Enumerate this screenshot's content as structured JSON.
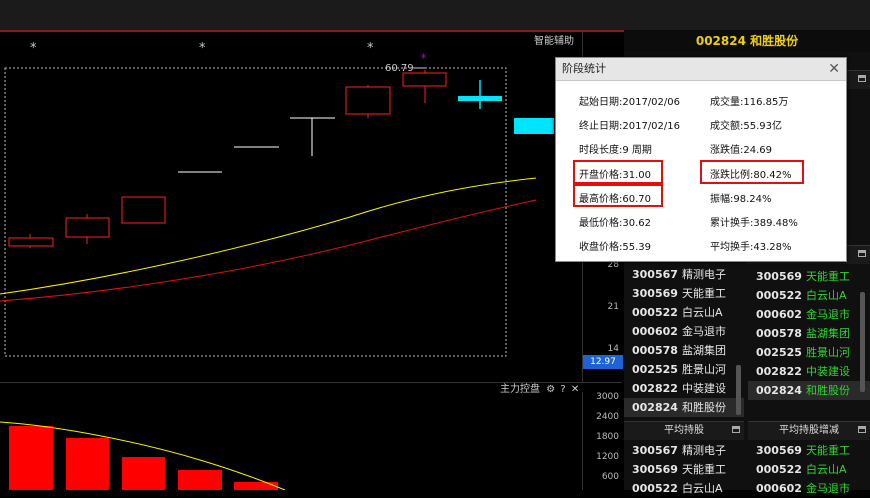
{
  "header": {
    "assist_label": "智能辅助",
    "stock_title": "002824 和胜股份"
  },
  "chart": {
    "peak_label": "60.79",
    "y_axis": [
      "28",
      "21",
      "14"
    ],
    "current_price": "12.97",
    "colors": {
      "up": "#ff2020",
      "ma_short": "#ffee00",
      "ma_long": "#e01010",
      "today": "#00e5ff",
      "marker": "#b000b0"
    }
  },
  "dialog": {
    "title": "阶段统计",
    "left": [
      "起始日期:2017/02/06",
      "终止日期:2017/02/16",
      "时段长度:9 周期",
      "开盘价格:31.00",
      "最高价格:60.70",
      "最低价格:30.62",
      "收盘价格:55.39"
    ],
    "right": [
      "成交量:116.85万",
      "成交额:55.93亿",
      "涨跌值:24.69",
      "涨跌比例:80.42%",
      "振幅:98.24%",
      "累计换手:389.48%",
      "平均换手:43.28%"
    ]
  },
  "lists": {
    "mid_left": [
      {
        "code": "300567",
        "name": "精测电子"
      },
      {
        "code": "300569",
        "name": "天能重工"
      },
      {
        "code": "000522",
        "name": "白云山A"
      },
      {
        "code": "000602",
        "name": "金马退市"
      },
      {
        "code": "000578",
        "name": "盐湖集团"
      },
      {
        "code": "002525",
        "name": "胜景山河"
      },
      {
        "code": "002822",
        "name": "中装建设"
      },
      {
        "code": "002824",
        "name": "和胜股份"
      }
    ],
    "mid_right": [
      {
        "code": "300569",
        "name": "天能重工"
      },
      {
        "code": "000522",
        "name": "白云山A"
      },
      {
        "code": "000602",
        "name": "金马退市"
      },
      {
        "code": "000578",
        "name": "盐湖集团"
      },
      {
        "code": "002525",
        "name": "胜景山河"
      },
      {
        "code": "002822",
        "name": "中装建设"
      },
      {
        "code": "002824",
        "name": "和胜股份"
      }
    ],
    "bottom_left_title": "平均持股",
    "bottom_right_title": "平均持股增减",
    "bottom_left": [
      {
        "code": "300567",
        "name": "精测电子"
      },
      {
        "code": "300569",
        "name": "天能重工"
      },
      {
        "code": "000522",
        "name": "白云山A"
      }
    ],
    "bottom_right": [
      {
        "code": "300569",
        "name": "天能重工"
      },
      {
        "code": "000522",
        "name": "白云山A"
      },
      {
        "code": "000602",
        "name": "金马退市"
      }
    ]
  },
  "subchart": {
    "title": "主力控盘",
    "icons": [
      "gear-icon",
      "help-icon",
      "close-icon"
    ],
    "y_axis": [
      "3000",
      "2400",
      "1800",
      "1200",
      "600"
    ]
  }
}
